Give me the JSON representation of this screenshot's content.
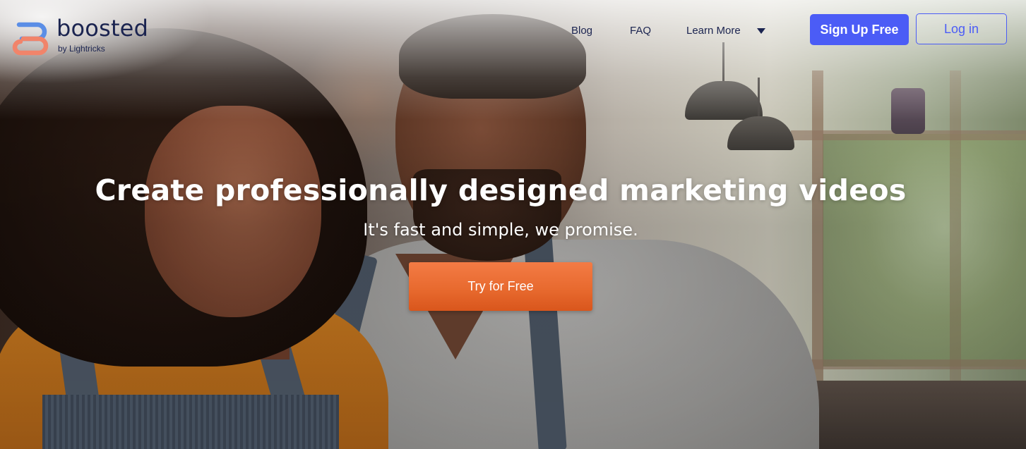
{
  "brand": {
    "name": "boosted",
    "tagline": "by Lightricks",
    "colors": {
      "primary": "#4b5cf6",
      "navy": "#1b2450",
      "cta": "#e86a2f",
      "logo_blue": "#5b8ee6",
      "logo_coral": "#f1846a"
    }
  },
  "nav": {
    "blog": "Blog",
    "faq": "FAQ",
    "learn_more": "Learn More",
    "learn_more_icon": "caret-down-icon",
    "signup": "Sign Up Free",
    "login": "Log in"
  },
  "hero": {
    "title": "Create professionally designed marketing videos",
    "subtitle": "It's fast and simple, we promise.",
    "cta": "Try for Free"
  }
}
